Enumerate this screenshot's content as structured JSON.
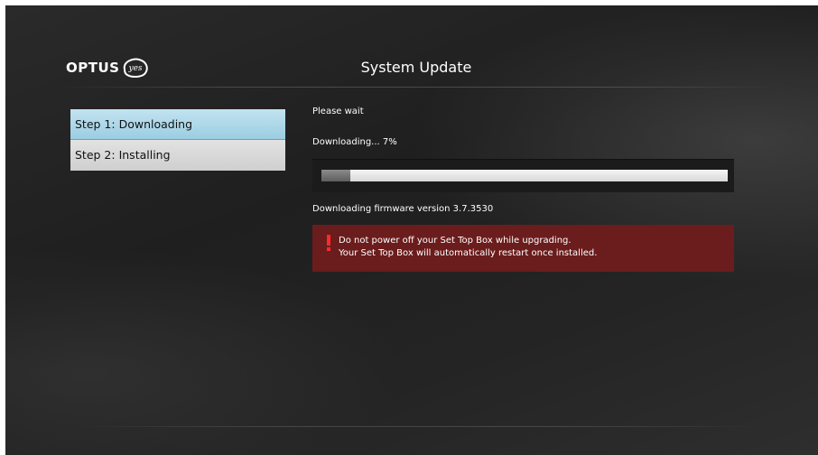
{
  "brand": {
    "name": "OPTUS",
    "tagline": "yes"
  },
  "header": {
    "title": "System Update"
  },
  "steps": [
    {
      "label": "Step 1: Downloading",
      "state": "active"
    },
    {
      "label": "Step 2: Installing",
      "state": "inactive"
    }
  ],
  "status": {
    "wait_text": "Please wait",
    "progress_text": "Downloading... 7%",
    "progress_percent": 7,
    "firmware_text": "Downloading firmware version 3.7.3530"
  },
  "warning": {
    "icon": "exclamation-icon",
    "line1": "Do not power off your Set Top Box while upgrading.",
    "line2": "Your Set Top Box will automatically restart once installed."
  },
  "colors": {
    "active_step": "#a9d6e9",
    "inactive_step": "#d8d8d8",
    "warning_bg": "#6b1c1c",
    "warning_mark": "#ff2a2a"
  }
}
